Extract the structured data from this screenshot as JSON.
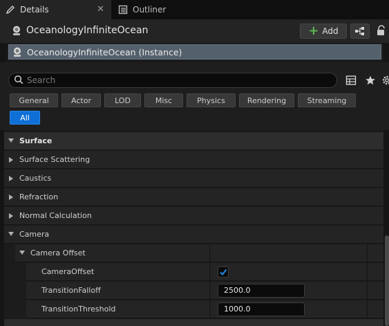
{
  "tabs": [
    {
      "label": "Details",
      "icon": "pencil-icon",
      "close": "✕"
    },
    {
      "label": "Outliner",
      "icon": "outliner-icon"
    }
  ],
  "header": {
    "actor_name": "OceanologyInfiniteOcean",
    "add_label": "Add"
  },
  "component": {
    "label": "OceanologyInfiniteOcean (Instance)"
  },
  "search": {
    "placeholder": "Search",
    "value": ""
  },
  "filters": {
    "row1": [
      "General",
      "Actor",
      "LOD",
      "Misc",
      "Physics",
      "Rendering",
      "Streaming"
    ],
    "all_label": "All",
    "selected": "All"
  },
  "tree": {
    "surface": "Surface",
    "surface_scattering": "Surface Scattering",
    "caustics": "Caustics",
    "refraction": "Refraction",
    "normal_calculation": "Normal Calculation",
    "camera": "Camera",
    "camera_offset": "Camera Offset",
    "props": {
      "camera_offset_label": "CameraOffset",
      "camera_offset_checked": true,
      "transition_falloff_label": "TransitionFalloff",
      "transition_falloff_value": "2500.0",
      "transition_threshold_label": "TransitionThreshold",
      "transition_threshold_value": "1000.0"
    }
  },
  "colors": {
    "accent": "#0e6fd6",
    "selected_row": "#54606c",
    "add_plus": "#5ab552"
  }
}
